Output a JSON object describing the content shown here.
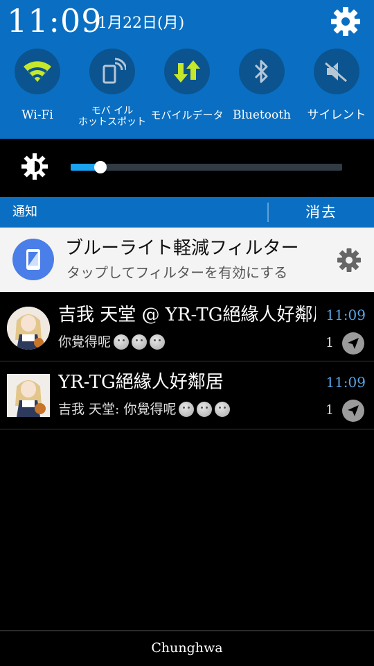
{
  "status": {
    "time": "11:09",
    "date": "1月22日(月)"
  },
  "quick_settings": [
    {
      "label": "Wi-Fi",
      "icon": "wifi-icon",
      "active": true
    },
    {
      "label": "モバ イル\nホットスポット",
      "icon": "hotspot-icon",
      "active": false
    },
    {
      "label": "モバイルデータ",
      "icon": "mobile-data-icon",
      "active": true
    },
    {
      "label": "Bluetooth",
      "icon": "bluetooth-icon",
      "active": false
    },
    {
      "label": "サイレント",
      "icon": "mute-icon",
      "active": false
    }
  ],
  "brightness": {
    "level": 0.11
  },
  "notification_bar": {
    "title": "通知",
    "clear_label": "消去"
  },
  "filter_notification": {
    "title": "ブルーライト軽減フィルター",
    "subtitle": "タップしてフィルターを有効にする"
  },
  "chats": [
    {
      "title": "吉我 天堂 @ YR-TG絕緣人好鄰居",
      "time": "11:09",
      "message": "你覺得呢",
      "emoji_count": 3,
      "count": "1"
    },
    {
      "title": "YR-TG絕緣人好鄰居",
      "time": "11:09",
      "message": "吉我 天堂: 你覺得呢",
      "emoji_count": 3,
      "count": "1"
    }
  ],
  "carrier": "Chunghwa",
  "colors": {
    "header_blue": "#0a6fc2",
    "active_green": "#c6e82a",
    "time_blue": "#5aa6e6",
    "slider_blue": "#1aa3ef"
  }
}
